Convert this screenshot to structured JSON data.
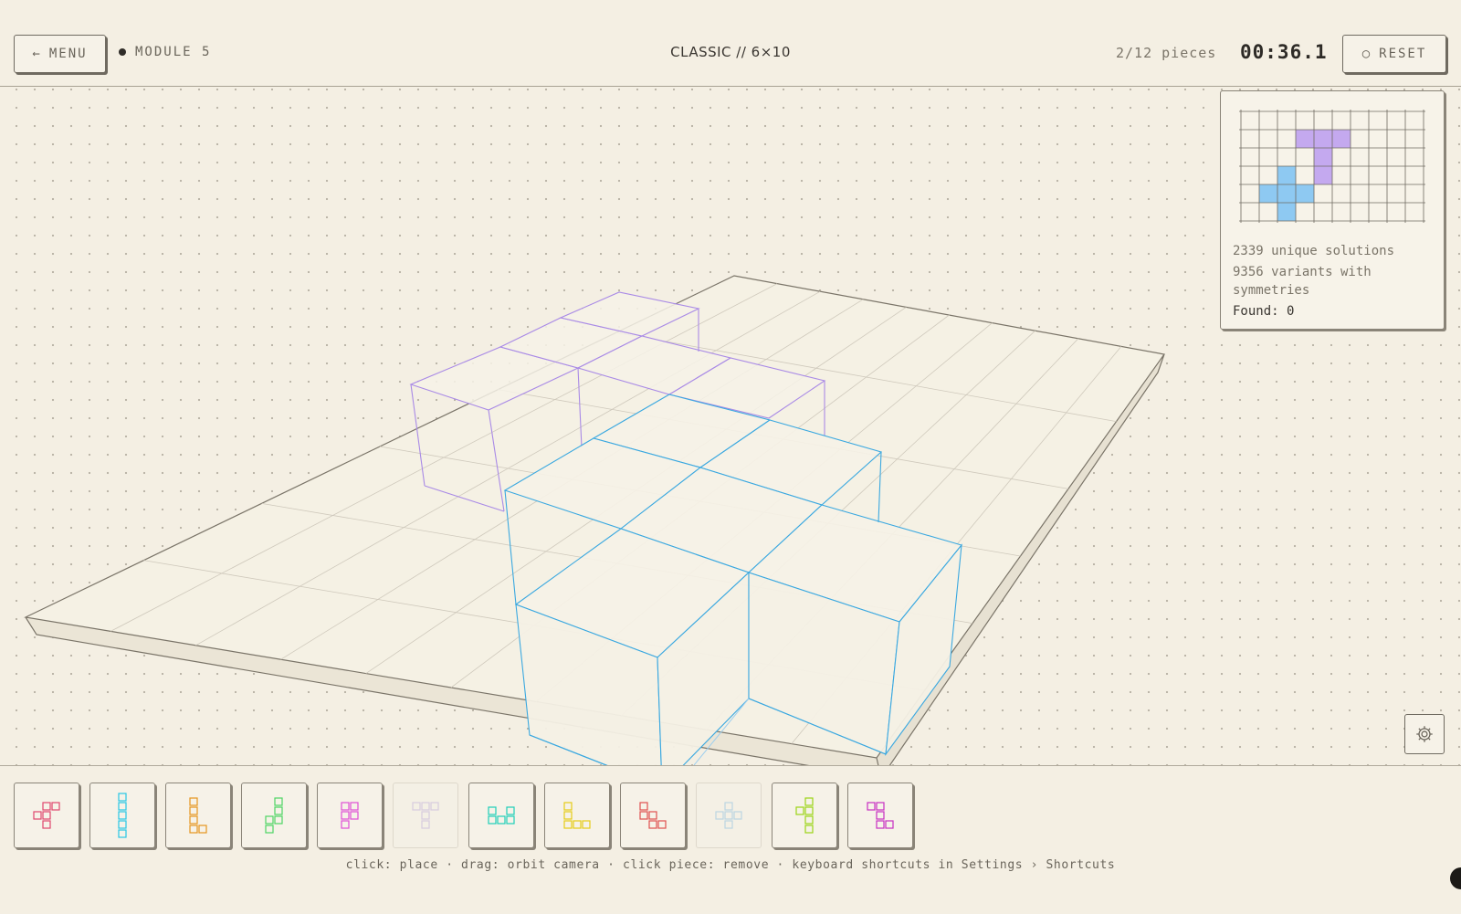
{
  "header": {
    "menu_label": "MENU",
    "menu_icon": "arrow-left-icon",
    "module_label": "MODULE 5",
    "mode_title": "CLASSIC // 6×10",
    "pieces_progress": "2/12 pieces",
    "timer": "00:36.1",
    "reset_label": "RESET",
    "reset_icon": "refresh-icon"
  },
  "info_panel": {
    "unique_solutions": "2339 unique solutions",
    "variants": "9356 variants with symmetries",
    "found": "Found: 0",
    "mini_board": {
      "cols": 10,
      "rows": 6,
      "filled": [
        {
          "piece": "purple",
          "color": "#c4a9ef",
          "cells": [
            [
              3,
              1
            ],
            [
              4,
              1
            ],
            [
              5,
              1
            ],
            [
              4,
              2
            ],
            [
              4,
              3
            ]
          ]
        },
        {
          "piece": "blue",
          "color": "#8ec9f2",
          "cells": [
            [
              2,
              3
            ],
            [
              1,
              4
            ],
            [
              2,
              4
            ],
            [
              3,
              4
            ],
            [
              2,
              5
            ]
          ]
        }
      ]
    }
  },
  "tray": {
    "pieces": [
      {
        "id": "F",
        "color": "#e0476e",
        "used": false,
        "cells": [
          [
            1,
            0
          ],
          [
            2,
            0
          ],
          [
            0,
            1
          ],
          [
            1,
            1
          ],
          [
            1,
            2
          ]
        ]
      },
      {
        "id": "I",
        "color": "#28c7e6",
        "used": false,
        "cells": [
          [
            0,
            0
          ],
          [
            0,
            1
          ],
          [
            0,
            2
          ],
          [
            0,
            3
          ],
          [
            0,
            4
          ]
        ]
      },
      {
        "id": "L",
        "color": "#e6961e",
        "used": false,
        "cells": [
          [
            0,
            0
          ],
          [
            0,
            1
          ],
          [
            0,
            2
          ],
          [
            0,
            3
          ],
          [
            1,
            3
          ]
        ]
      },
      {
        "id": "N",
        "color": "#4ed464",
        "used": false,
        "cells": [
          [
            1,
            0
          ],
          [
            1,
            1
          ],
          [
            1,
            2
          ],
          [
            0,
            2
          ],
          [
            0,
            3
          ]
        ]
      },
      {
        "id": "P",
        "color": "#df4fd6",
        "used": false,
        "cells": [
          [
            0,
            0
          ],
          [
            1,
            0
          ],
          [
            0,
            1
          ],
          [
            1,
            1
          ],
          [
            0,
            2
          ]
        ]
      },
      {
        "id": "T",
        "color": "#b6a2dc",
        "used": true,
        "cells": [
          [
            0,
            0
          ],
          [
            1,
            0
          ],
          [
            2,
            0
          ],
          [
            1,
            1
          ],
          [
            1,
            2
          ]
        ]
      },
      {
        "id": "U",
        "color": "#1fcfb8",
        "used": false,
        "cells": [
          [
            0,
            0
          ],
          [
            2,
            0
          ],
          [
            0,
            1
          ],
          [
            1,
            1
          ],
          [
            2,
            1
          ]
        ]
      },
      {
        "id": "V",
        "color": "#e6cc16",
        "used": false,
        "cells": [
          [
            0,
            0
          ],
          [
            0,
            1
          ],
          [
            0,
            2
          ],
          [
            1,
            2
          ],
          [
            2,
            2
          ]
        ]
      },
      {
        "id": "W",
        "color": "#e0514f",
        "used": false,
        "cells": [
          [
            0,
            0
          ],
          [
            0,
            1
          ],
          [
            1,
            1
          ],
          [
            1,
            2
          ],
          [
            2,
            2
          ]
        ]
      },
      {
        "id": "X",
        "color": "#7ab8e2",
        "used": true,
        "cells": [
          [
            1,
            0
          ],
          [
            0,
            1
          ],
          [
            1,
            1
          ],
          [
            2,
            1
          ],
          [
            1,
            2
          ]
        ]
      },
      {
        "id": "Y",
        "color": "#9bd416",
        "used": false,
        "cells": [
          [
            1,
            0
          ],
          [
            0,
            1
          ],
          [
            1,
            1
          ],
          [
            1,
            2
          ],
          [
            1,
            3
          ]
        ]
      },
      {
        "id": "Z",
        "color": "#c72ec2",
        "used": false,
        "cells": [
          [
            0,
            0
          ],
          [
            1,
            0
          ],
          [
            1,
            1
          ],
          [
            1,
            2
          ],
          [
            2,
            2
          ]
        ]
      }
    ]
  },
  "hint": "click: place · drag: orbit camera · click piece: remove · keyboard shortcuts in Settings › Shortcuts",
  "settings_icon": "gear-icon",
  "colors": {
    "background": "#f4efe3",
    "ink": "#2e2b27",
    "placed_purple": "#a98ae6",
    "placed_blue": "#3aa8e0"
  }
}
